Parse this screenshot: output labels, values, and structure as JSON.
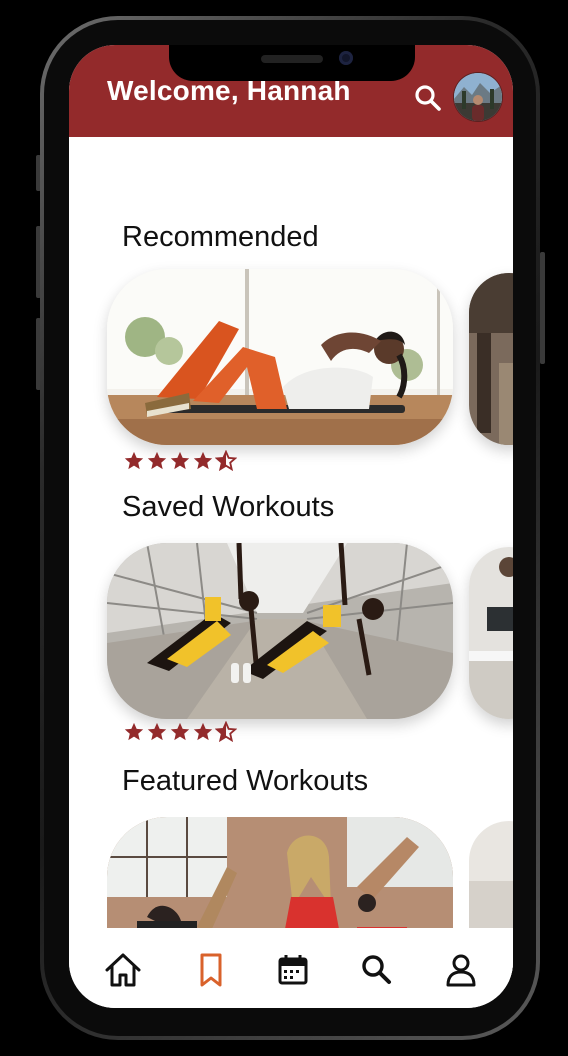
{
  "header": {
    "welcome_text": "Welcome, Hannah",
    "search_icon": "search-icon",
    "avatar_icon": "avatar"
  },
  "sections": [
    {
      "title": "Recommended",
      "rating": 4.5,
      "main_card": "woman doing crunches on mat",
      "peek_card": "gym interior"
    },
    {
      "title": "Saved Workouts",
      "rating": 4.5,
      "main_card": "two women doing side planks on bridge",
      "peek_card": "person on bench"
    },
    {
      "title": "Featured Workouts",
      "main_card": "women exercising in studio",
      "peek_card": "light room"
    }
  ],
  "bottom_nav": {
    "items": [
      {
        "icon": "home-icon",
        "active": false
      },
      {
        "icon": "bookmark-icon",
        "active": true
      },
      {
        "icon": "calendar-icon",
        "active": false
      },
      {
        "icon": "search-icon",
        "active": false
      },
      {
        "icon": "profile-icon",
        "active": false
      }
    ]
  },
  "colors": {
    "brand": "#932a2b",
    "star": "#932a2b",
    "active_nav": "#d9622b",
    "nav_icon": "#111111"
  }
}
